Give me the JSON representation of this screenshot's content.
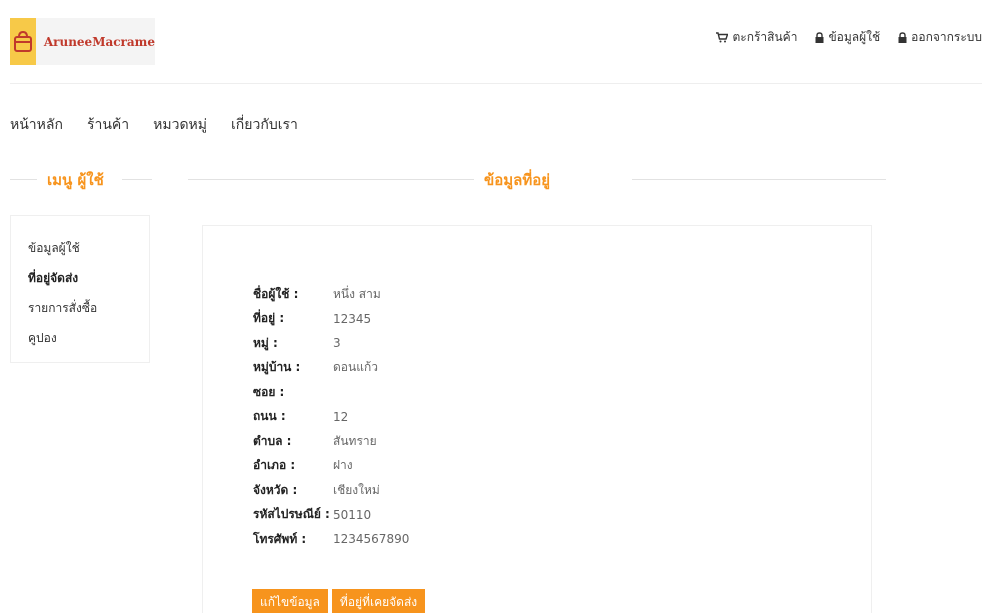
{
  "brand": {
    "name": "AruneeMacrame",
    "color": "#f7c948",
    "text_color": "#c0392b"
  },
  "topnav": {
    "cart": "ตะกร้าสินค้า",
    "user_info": "ข้อมูลผู้ใช้",
    "logout": "ออกจากระบบ"
  },
  "mainnav": [
    "หน้าหลัก",
    "ร้านค้า",
    "หมวดหมู่",
    "เกี่ยวกับเรา"
  ],
  "sidebar": {
    "title": "เมนู ผู้ใช้",
    "items": [
      "ข้อมูลผู้ใช้",
      "ที่อยู่จัดส่ง",
      "รายการสั่งซื้อ",
      "คูปอง"
    ],
    "active_index": 1
  },
  "content": {
    "title": "ข้อมูลที่อยู่",
    "fields": [
      {
        "label": "ชื่อผู้ใช้ :",
        "value": "หนึ่ง สาม"
      },
      {
        "label": "ที่อยู่ :",
        "value": "12345"
      },
      {
        "label": "หมู่ :",
        "value": "3"
      },
      {
        "label": "หมู่บ้าน :",
        "value": "ดอนแก้ว"
      },
      {
        "label": "ซอย :",
        "value": ""
      },
      {
        "label": "ถนน :",
        "value": "12"
      },
      {
        "label": "ตำบล :",
        "value": "สันทราย"
      },
      {
        "label": "อำเภอ :",
        "value": "ฝาง"
      },
      {
        "label": "จังหวัด :",
        "value": "เชียงใหม่"
      },
      {
        "label": "รหัสไปรษณีย์ :",
        "value": "50110"
      },
      {
        "label": "โทรศัพท์ :",
        "value": "1234567890"
      }
    ],
    "edit_button": "แก้ไขข้อมูล",
    "previous_addresses_button": "ที่อยู่ที่เคยจัดส่ง"
  },
  "accent_color": "#f7941d"
}
